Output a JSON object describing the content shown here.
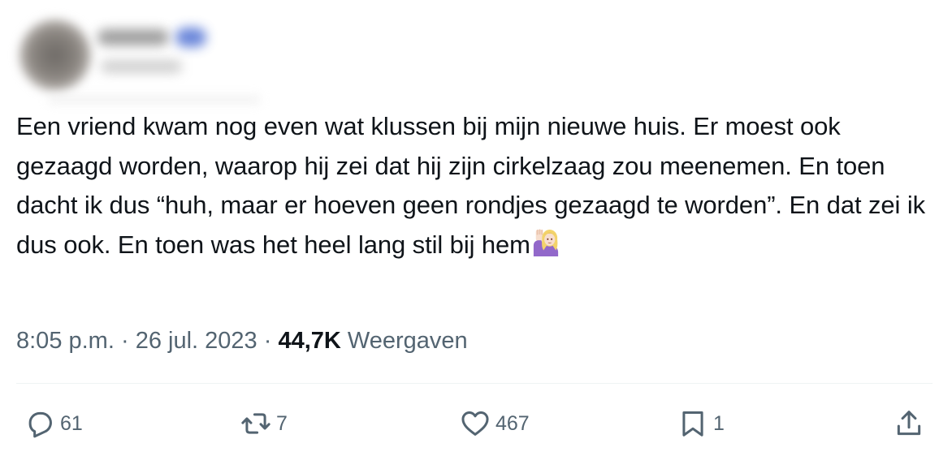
{
  "tweet": {
    "body": "Een vriend kwam nog even wat klussen bij mijn nieuwe huis. Er moest ook gezaagd worden, waarop hij zei dat hij zijn cirkelzaag zou meenemen. En toen dacht ik dus “huh, maar er hoeven geen rondjes gezaagd te worden”. En dat zei ik dus ook. En toen was het heel lang stil bij hem",
    "emoji": "person-raising-hand-emoji",
    "time": "8:05 p.m.",
    "separator": " · ",
    "date": "26 jul. 2023",
    "views_count": "44,7K",
    "views_label": "Weergaven"
  },
  "actions": {
    "reply": {
      "icon": "reply-icon",
      "count": "61"
    },
    "retweet": {
      "icon": "retweet-icon",
      "count": "7"
    },
    "like": {
      "icon": "heart-icon",
      "count": "467"
    },
    "bookmark": {
      "icon": "bookmark-icon",
      "count": "1"
    },
    "share": {
      "icon": "share-icon"
    }
  },
  "colors": {
    "text": "#0f1419",
    "secondary": "#536471",
    "divider": "#eff3f4"
  }
}
